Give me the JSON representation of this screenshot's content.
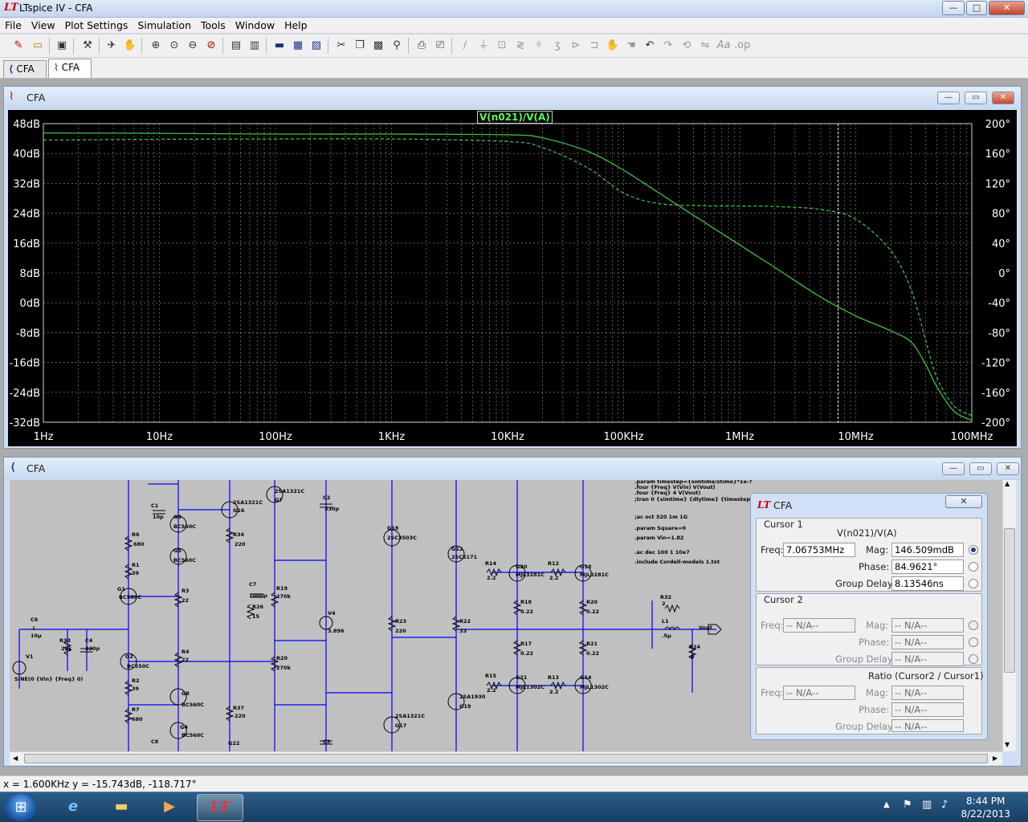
{
  "app": {
    "title": "LTspice IV - CFA",
    "window_controls": {
      "minimize": "—",
      "maximize": "□",
      "close": "✕"
    }
  },
  "menu": [
    "File",
    "View",
    "Plot Settings",
    "Simulation",
    "Tools",
    "Window",
    "Help"
  ],
  "toolbar_icons": [
    "new-schematic-icon",
    "open-icon",
    "save-icon",
    "control-panel-icon",
    "run-icon",
    "halt-icon",
    "pan-icon",
    "zoom-in-icon",
    "zoom-area-icon",
    "zoom-out-icon",
    "zoom-cancel-icon",
    "autorange-icon",
    "tile-vertical-icon",
    "cascade-icon",
    "tile-horizontal-icon",
    "close-window-icon",
    "cut-icon",
    "copy-icon",
    "paste-icon",
    "find-icon",
    "print-icon",
    "print-preview-icon",
    "wire-icon",
    "ground-icon",
    "label-icon",
    "resistor-icon",
    "capacitor-icon",
    "inductor-icon",
    "diode-icon",
    "component-icon",
    "move-icon",
    "drag-icon",
    "undo-icon",
    "redo-icon",
    "rotate-icon",
    "mirror-icon",
    "text-icon",
    "spice-directive-icon"
  ],
  "tabs": [
    {
      "label": "CFA",
      "kind": "schematic"
    },
    {
      "label": "CFA",
      "kind": "plot"
    }
  ],
  "plot_window": {
    "title": "CFA",
    "trace_label": "V(n021)/V(A)"
  },
  "chart_data": {
    "type": "line",
    "title": "V(n021)/V(A)",
    "x_scale": "log",
    "x_ticks": [
      "1Hz",
      "10Hz",
      "100Hz",
      "1KHz",
      "10KHz",
      "100KHz",
      "1MHz",
      "10MHz",
      "100MHz"
    ],
    "xlim": [
      1,
      100000000
    ],
    "y_left_ticks": [
      "48dB",
      "40dB",
      "32dB",
      "24dB",
      "16dB",
      "8dB",
      "0dB",
      "-8dB",
      "-16dB",
      "-24dB",
      "-32dB"
    ],
    "ylim_left": [
      -32,
      48
    ],
    "y_right_ticks": [
      "200°",
      "160°",
      "120°",
      "80°",
      "40°",
      "0°",
      "-40°",
      "-80°",
      "-120°",
      "-160°",
      "-200°"
    ],
    "ylim_right": [
      -200,
      200
    ],
    "grid": true,
    "cursor_x": 7067530,
    "series": [
      {
        "name": "magnitude",
        "style": "solid",
        "color": "#3ec23e",
        "axis": "left",
        "x": [
          1,
          10,
          100,
          1000,
          10000,
          20000,
          50000,
          100000,
          200000,
          500000,
          1000000,
          2000000,
          5000000,
          10000000,
          20000000,
          30000000,
          40000000,
          50000000,
          70000000,
          100000000
        ],
        "y": [
          45.5,
          45.4,
          45.2,
          45.2,
          45.0,
          44.2,
          40.5,
          35.5,
          29.5,
          21.5,
          15.5,
          9.5,
          1.5,
          -3.5,
          -7.5,
          -10.5,
          -16.5,
          -22.5,
          -29.0,
          -31.5
        ]
      },
      {
        "name": "phase",
        "style": "dashed",
        "color": "#3ec23e",
        "axis": "right",
        "x": [
          1,
          10,
          100,
          1000,
          10000,
          20000,
          50000,
          100000,
          200000,
          500000,
          1000000,
          2000000,
          5000000,
          10000000,
          20000000,
          30000000,
          40000000,
          50000000,
          70000000,
          100000000
        ],
        "y": [
          178,
          179,
          179.5,
          179.5,
          176,
          168,
          140,
          107,
          93,
          90,
          89.5,
          89,
          85,
          72,
          30,
          -22,
          -90,
          -140,
          -178,
          -191
        ]
      }
    ]
  },
  "schematic_window": {
    "title": "CFA",
    "directives": [
      ".param timestep={simtime/stime}*1e-?",
      ".four {Freq} V(Vin) V(Vout)",
      ".four {Freq} 4 V(Vout)",
      ";tran 0 {simtime} {dlytime} {timestep}",
      ";ac oct 320 1m 1G",
      ".param Square=0",
      ".param Vin=1.82",
      ".ac dec 100 1 10e7",
      ".include Cordell-models 1.txt"
    ],
    "labels": [
      "2SA1321C",
      "G7",
      "2SA1321C",
      "G16",
      "C1",
      "10p",
      "G3",
      "BC560C",
      "R34",
      "220",
      "C2",
      "330p",
      "G18",
      "2SC3503C",
      "G12",
      "2SC5171",
      "R14",
      "2.2",
      "G20",
      "MJL3281C",
      "R12",
      "2.2",
      "G13",
      "MJL3281C",
      "R6",
      "680",
      "G5",
      "BC560C",
      "R1",
      "39",
      "R3",
      "22",
      "C7",
      "1000µ",
      "R26",
      "15",
      "R19",
      "270k",
      "V4",
      "3.896",
      "R23",
      "220",
      "R22",
      "33",
      "R18",
      "0.22",
      "R20",
      "0.22",
      "R32",
      "2",
      "L1",
      ".5µ",
      "Vout",
      "C6",
      "10µ",
      "R33",
      "22k",
      "C4",
      "330p",
      "G1",
      "BC560C",
      "R4",
      "22",
      "R17",
      "0.22",
      "R21",
      "0.22",
      "R24",
      "8",
      "V1",
      "SINE(0 {Vin} {Freq} 0)",
      "G2",
      "BC550C",
      "R20",
      "270k",
      "R2",
      "39",
      "G8",
      "BC560C",
      "R37",
      "220",
      "R15",
      "2.2",
      "G21",
      "MJL1302C",
      "R13",
      "2.2",
      "G14",
      "MJL1302C",
      "R7",
      "680",
      "2SA1930",
      "G19",
      "2SA1321C",
      "G17",
      "G4",
      "BC560C",
      "C8",
      "G22",
      "C3"
    ]
  },
  "cursor_panel": {
    "title": "CFA",
    "close": "✕",
    "cursor1_title": "Cursor 1",
    "trace": "V(n021)/V(A)",
    "freq_label": "Freq:",
    "freq": "7.06753MHz",
    "mag_label": "Mag:",
    "mag": "146.509mdB",
    "phase_label": "Phase:",
    "phase": "84.9621°",
    "group_delay_label": "Group Delay:",
    "group_delay": "8.13546ns",
    "cursor2_title": "Cursor 2",
    "na": "-- N/A--",
    "ratio_title": "Ratio (Cursor2 / Cursor1)"
  },
  "status": {
    "text": "x = 1.600KHz    y = -15.743dB, -118.717°"
  },
  "taskbar": {
    "time": "8:44 PM",
    "date": "8/22/2013",
    "apps": [
      "start-orb-icon",
      "internet-explorer-icon",
      "explorer-icon",
      "media-player-icon",
      "ltspice-icon"
    ]
  },
  "colors": {
    "trace": "#3ec23e",
    "plot_bg": "#000000",
    "axis_text": "#ffffff",
    "wire": "#0000ff",
    "schematic_bg": "#c0c0c0"
  }
}
